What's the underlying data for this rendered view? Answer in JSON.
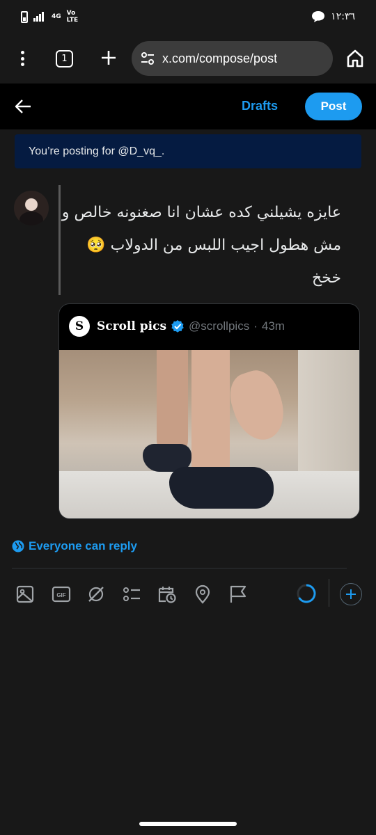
{
  "status_bar": {
    "network_4g": "4G",
    "network_volte_top": "Vo",
    "network_volte_bottom": "LTE",
    "time": "١٢:٣٦"
  },
  "browser": {
    "tab_count": "1",
    "url": "x.com/compose/post"
  },
  "header": {
    "drafts_label": "Drafts",
    "post_label": "Post"
  },
  "banner": {
    "text": "You’re posting for @D_vq_."
  },
  "compose": {
    "text": "عايزه يشيلني كده عشان انا صغنونه خالص و مش هطول اجيب اللبس من الدولاب 🥺 خخخ"
  },
  "quote": {
    "logo_letter": "S",
    "name": "Scroll pics",
    "handle": "@scrollpics",
    "separator": "·",
    "time": "43m"
  },
  "reply_setting": {
    "label": "Everyone can reply"
  },
  "colors": {
    "accent": "#1d9bf0",
    "background": "#181818",
    "header_bg": "#000000",
    "banner_bg": "#051b41"
  },
  "icons": [
    "more-vert-icon",
    "tabs-icon",
    "plus-icon",
    "site-settings-icon",
    "home-icon",
    "back-arrow-icon",
    "verified-badge-icon",
    "globe-icon",
    "image-icon",
    "gif-icon",
    "grok-icon",
    "poll-icon",
    "schedule-icon",
    "location-icon",
    "flag-icon",
    "add-post-icon"
  ]
}
